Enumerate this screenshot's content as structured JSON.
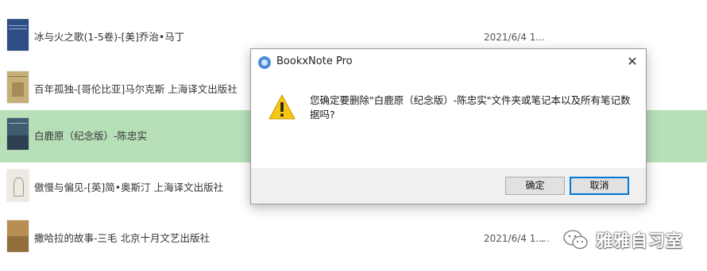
{
  "books": [
    {
      "title": "冰与火之歌(1-5卷)-[美]乔治•马丁",
      "date": "2021/6/4 1...",
      "cover_color": "#2c4d86",
      "selected": false
    },
    {
      "title": "百年孤独-[哥伦比亚]马尔克斯 上海译文出版社",
      "date": "",
      "cover_color": "#c6b07a",
      "selected": false
    },
    {
      "title": "白鹿原（纪念版）-陈忠实",
      "date": "",
      "cover_color": "#3f5c72",
      "selected": true
    },
    {
      "title": "傲慢与偏见-[英]简•奥斯汀 上海译文出版社",
      "date": "",
      "cover_color": "#eeeae2",
      "selected": false
    },
    {
      "title": "撒哈拉的故事-三毛 北京十月文艺出版社",
      "date": "2021/6/4 1...",
      "cover_color": "#b98e52",
      "selected": false
    }
  ],
  "more_indicator": "…",
  "dialog": {
    "title": "BookxNote Pro",
    "close_icon": "close-icon",
    "message": "您确定要删除\"白鹿原（纪念版）-陈忠实\"文件夹或笔记本以及所有笔记数据吗?",
    "icon": "warning-icon",
    "ok_label": "确定",
    "cancel_label": "取消",
    "accent_color": "#0078d7"
  },
  "watermark": {
    "text": "雅雅自习室",
    "icon": "wechat-icon"
  },
  "colors": {
    "selected_row": "#b7e0b8",
    "warning": "#f7c514"
  }
}
